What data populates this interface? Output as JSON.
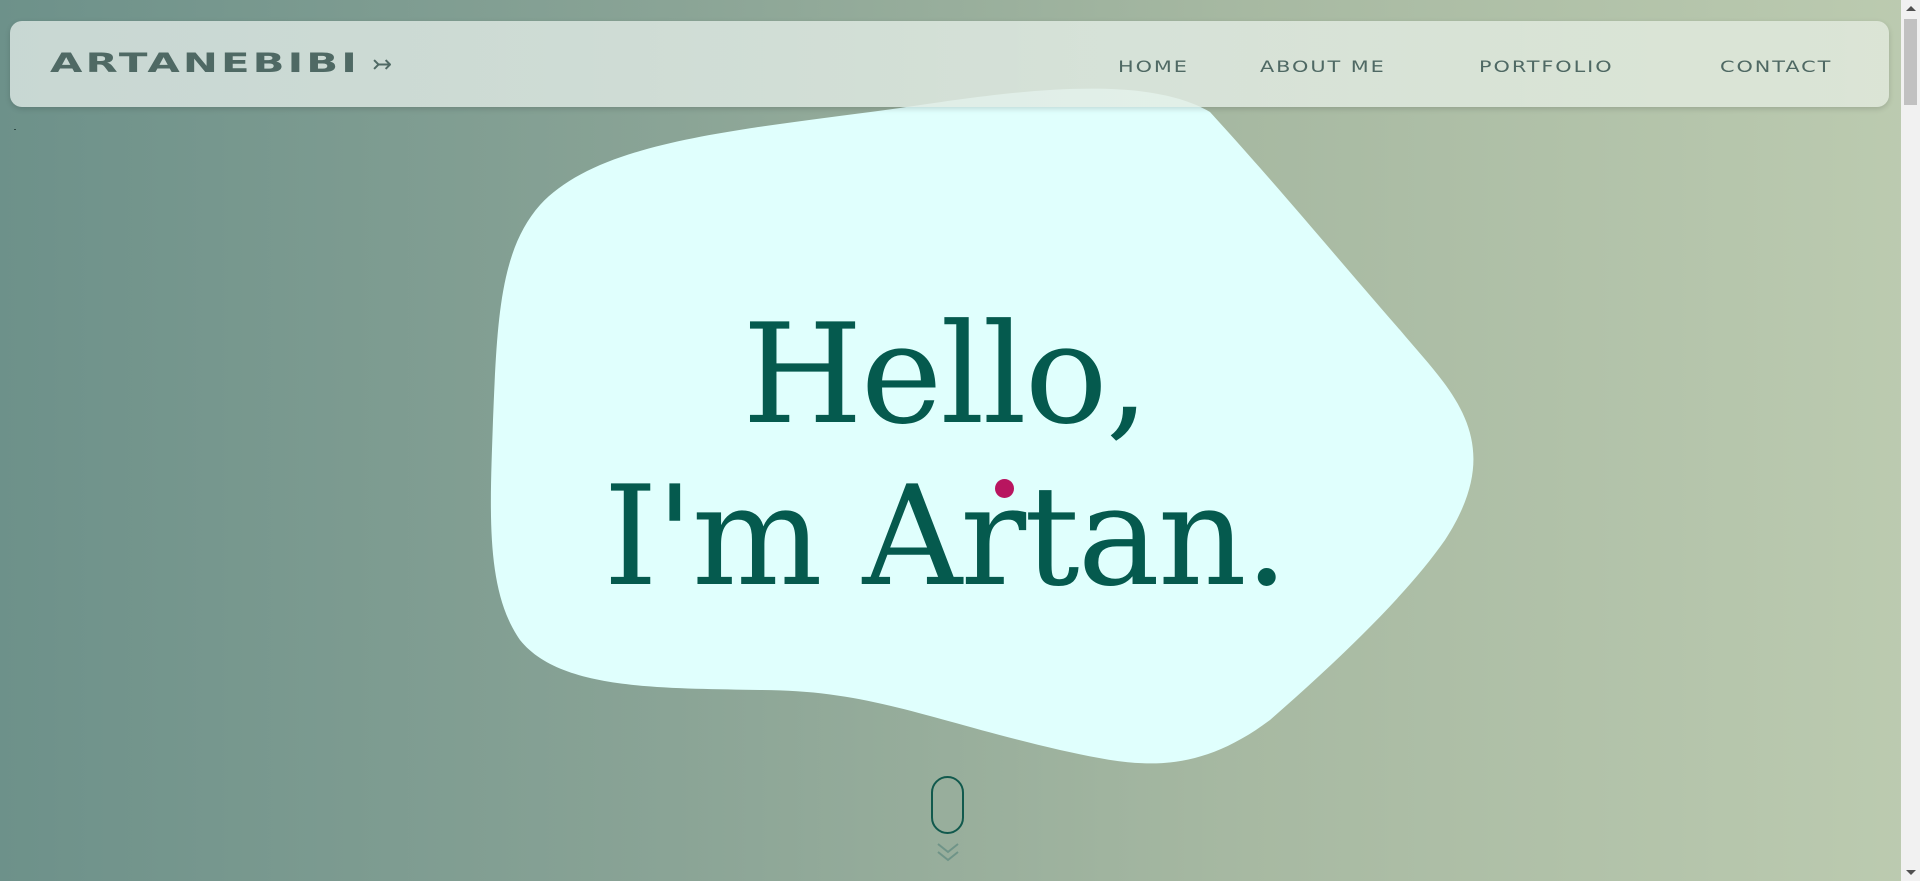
{
  "nav": {
    "logo": "ARTANEBIBI",
    "logo_arrow": "↣",
    "links": [
      "HOME",
      "ABOUT ME",
      "PORTFOLIO",
      "CONTACT"
    ]
  },
  "hero": {
    "line1": "Hello,",
    "line2": "I'm Artan.",
    "blob_color": "#e0fffd",
    "text_color": "#055a4e",
    "accent_color": "#b8155f"
  },
  "scroll_hint": {
    "icon": "mouse-scroll-icon",
    "chevrons": "double-chevron-down-icon"
  }
}
